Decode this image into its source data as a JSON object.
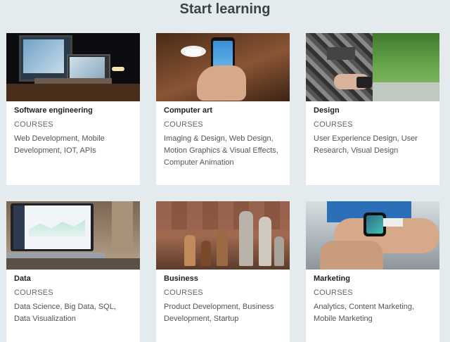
{
  "page": {
    "title": "Start learning"
  },
  "cards": [
    {
      "title": "Software engineering",
      "kind": "COURSES",
      "topics": "Web Development, Mobile Development, IOT, APIs",
      "image": "desk-computer-monitors-photo"
    },
    {
      "title": "Computer art",
      "kind": "COURSES",
      "topics": "Imaging & Design, Web Design, Motion Graphics & Visual Effects, Computer Animation",
      "image": "hand-holding-phone-photo"
    },
    {
      "title": "Design",
      "kind": "COURSES",
      "topics": "User Experience Design, User Research, Visual Design",
      "image": "person-with-camera-photo"
    },
    {
      "title": "Data",
      "kind": "COURSES",
      "topics": "Data Science, Big Data, SQL, Data Visualization",
      "image": "laptop-dashboard-photo"
    },
    {
      "title": "Business",
      "kind": "COURSES",
      "topics": "Product Development, Business Development, Startup",
      "image": "chess-pieces-photo"
    },
    {
      "title": "Marketing",
      "kind": "COURSES",
      "topics": "Analytics, Content Marketing, Mobile Marketing",
      "image": "smartwatch-wrist-photo"
    }
  ]
}
